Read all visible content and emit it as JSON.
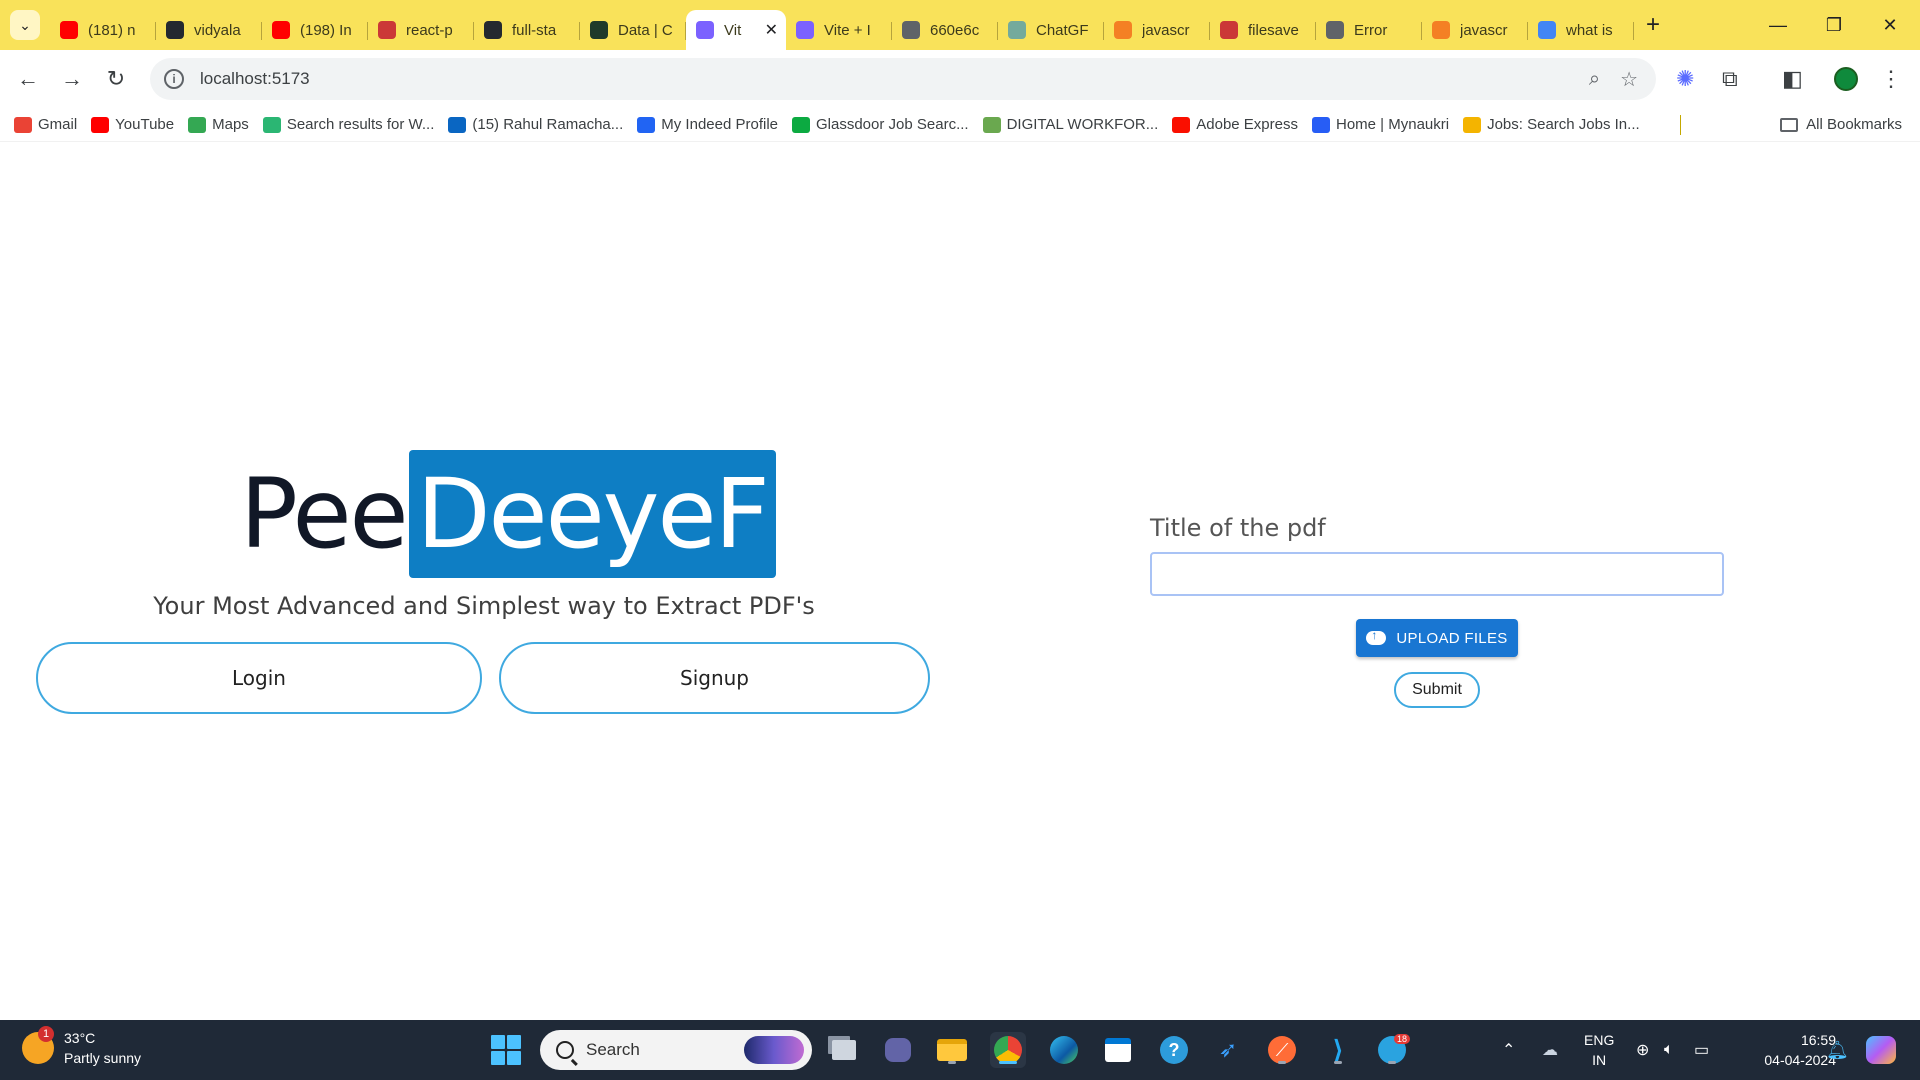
{
  "browser": {
    "tabs": [
      {
        "label": "(181) n",
        "icon": "youtube-icon",
        "color": "#ff0000"
      },
      {
        "label": "vidyala",
        "icon": "github-icon",
        "color": "#24292f"
      },
      {
        "label": "(198) In",
        "icon": "youtube-icon",
        "color": "#ff0000"
      },
      {
        "label": "react-p",
        "icon": "npm-icon",
        "color": "#cb3837"
      },
      {
        "label": "full-sta",
        "icon": "github-icon",
        "color": "#24292f"
      },
      {
        "label": "Data | C",
        "icon": "mongodb-icon",
        "color": "#1f3a2a"
      },
      {
        "label": "Vit",
        "icon": "vite-icon",
        "color": "#7b61ff",
        "active": true
      },
      {
        "label": "Vite + I",
        "icon": "vite-icon",
        "color": "#7b61ff"
      },
      {
        "label": "660e6c",
        "icon": "globe-icon",
        "color": "#5f6368"
      },
      {
        "label": "ChatGF",
        "icon": "chatgpt-icon",
        "color": "#74aa9c"
      },
      {
        "label": "javascr",
        "icon": "stackoverflow-icon",
        "color": "#f48024"
      },
      {
        "label": "filesave",
        "icon": "npm-icon",
        "color": "#cb3837"
      },
      {
        "label": "Error",
        "icon": "globe-icon",
        "color": "#5f6368"
      },
      {
        "label": "javascr",
        "icon": "stackoverflow-icon",
        "color": "#f48024"
      },
      {
        "label": "what is",
        "icon": "google-icon",
        "color": "#4285f4"
      }
    ],
    "address": "localhost:5173",
    "bookmarks": [
      {
        "label": "Gmail",
        "icon": "gmail-icon",
        "color": "#ea4335"
      },
      {
        "label": "YouTube",
        "icon": "youtube-icon",
        "color": "#ff0000"
      },
      {
        "label": "Maps",
        "icon": "maps-icon",
        "color": "#34a853"
      },
      {
        "label": "Search results for W...",
        "icon": "bookmark-icon",
        "color": "#2bb673"
      },
      {
        "label": "(15) Rahul Ramacha...",
        "icon": "linkedin-icon",
        "color": "#0a66c2"
      },
      {
        "label": "My Indeed Profile",
        "icon": "indeed-icon",
        "color": "#2164f3"
      },
      {
        "label": "Glassdoor Job Searc...",
        "icon": "glassdoor-icon",
        "color": "#0caa41"
      },
      {
        "label": "DIGITAL WORKFOR...",
        "icon": "bookmark-icon",
        "color": "#6aa84f"
      },
      {
        "label": "Adobe Express",
        "icon": "adobe-icon",
        "color": "#fa0f00"
      },
      {
        "label": "Home | Mynaukri",
        "icon": "mynaukri-icon",
        "color": "#275df5"
      },
      {
        "label": "Jobs: Search Jobs In...",
        "icon": "jobs-icon",
        "color": "#f4b400"
      }
    ],
    "all_bookmarks": "All Bookmarks"
  },
  "page": {
    "logo_part1": "Pee",
    "logo_part2": "DeeyeF",
    "tagline": "Your Most Advanced and Simplest way to Extract PDF's",
    "login_label": "Login",
    "signup_label": "Signup",
    "pdf_title_label": "Title of the pdf",
    "pdf_title_value": "",
    "upload_label": "UPLOAD FILES",
    "submit_label": "Submit",
    "accent_color": "#0e7ec4"
  },
  "taskbar": {
    "temperature": "33°C",
    "weather": "Partly sunny",
    "weather_badge": "1",
    "search_placeholder": "Search",
    "telegram_badge": "18",
    "lang_line1": "ENG",
    "lang_line2": "IN",
    "time": "16:59",
    "date": "04-04-2024"
  }
}
